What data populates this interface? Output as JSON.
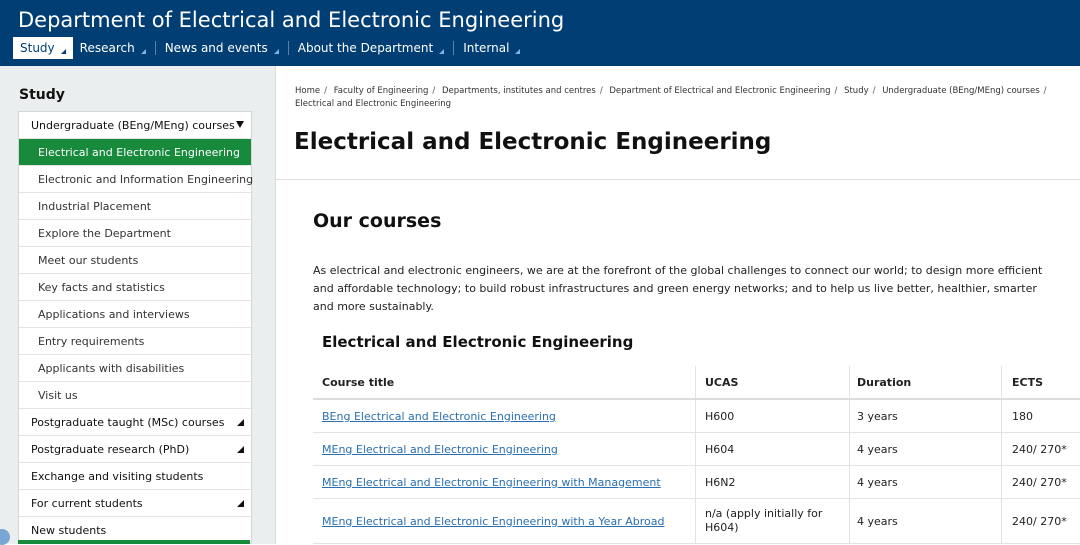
{
  "header": {
    "title": "Department of Electrical and Electronic Engineering",
    "nav": [
      {
        "label": "Study"
      },
      {
        "label": "Research"
      },
      {
        "label": "News and events"
      },
      {
        "label": "About the Department"
      },
      {
        "label": "Internal"
      }
    ]
  },
  "sidebar": {
    "title": "Study",
    "items": [
      {
        "label": "Undergraduate (BEng/MEng) courses"
      },
      {
        "label": "Electrical and Electronic Engineering"
      },
      {
        "label": "Electronic and Information Engineering"
      },
      {
        "label": "Industrial Placement"
      },
      {
        "label": "Explore the Department"
      },
      {
        "label": "Meet our students"
      },
      {
        "label": "Key facts and statistics"
      },
      {
        "label": "Applications and interviews"
      },
      {
        "label": "Entry requirements"
      },
      {
        "label": "Applicants with disabilities"
      },
      {
        "label": "Visit us"
      },
      {
        "label": "Postgraduate taught (MSc) courses"
      },
      {
        "label": "Postgraduate research (PhD)"
      },
      {
        "label": "Exchange and visiting students"
      },
      {
        "label": "For current students"
      },
      {
        "label": "New students"
      }
    ]
  },
  "breadcrumb": [
    "Home",
    "Faculty of Engineering",
    "Departments, institutes and centres",
    "Department of Electrical and Electronic Engineering",
    "Study",
    "Undergraduate (BEng/MEng) courses",
    "Electrical and Electronic Engineering"
  ],
  "main": {
    "page_title": "Electrical and Electronic Engineering",
    "section_title": "Our courses",
    "intro": "As electrical and electronic engineers, we are at the forefront of the global challenges to connect our world; to design more efficient and affordable technology; to build robust infrastructures and green energy networks; and to help us live better, healthier, smarter and more sustainably.",
    "sub_title": "Electrical and Electronic Engineering",
    "table": {
      "headers": [
        "Course title",
        "UCAS",
        "Duration",
        "ECTS"
      ],
      "rows": [
        {
          "title": "BEng Electrical and Electronic Engineering",
          "ucas": "H600",
          "duration": "3 years",
          "ects": "180"
        },
        {
          "title": "MEng Electrical and Electronic Engineering",
          "ucas": "H604",
          "duration": "4 years",
          "ects": "240/ 270*"
        },
        {
          "title": "MEng Electrical and Electronic Engineering with Management",
          "ucas": "H6N2",
          "duration": "4 years",
          "ects": "240/ 270*"
        },
        {
          "title": "MEng Electrical and Electronic Engineering with a Year Abroad",
          "ucas": "n/a (apply initially for H604)",
          "duration": "4 years",
          "ects": "240/ 270*"
        }
      ]
    }
  }
}
